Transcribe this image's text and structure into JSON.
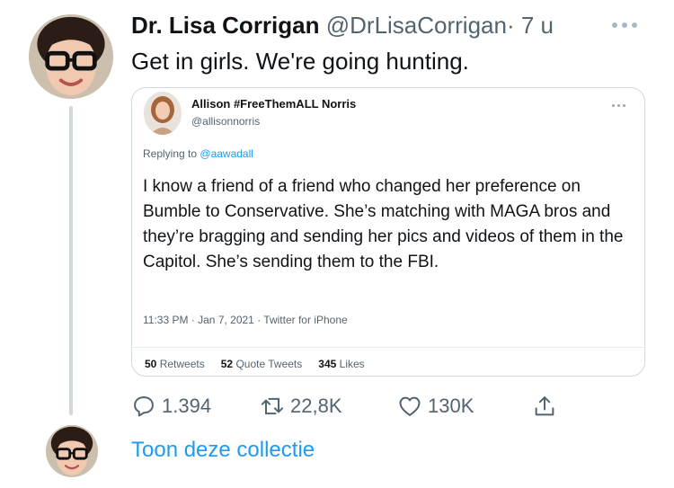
{
  "tweet": {
    "author_name": "Dr. Lisa Corrigan",
    "author_handle": "@DrLisaCorrigan",
    "separator": "·",
    "timestamp": "7 u",
    "text": "Get in girls. We're going hunting.",
    "avatar_icon": "person-with-glasses-avatar"
  },
  "quoted_tweet": {
    "author_name": "Allison #FreeThemALL Norris",
    "author_handle": "@allisonnorris",
    "replying_prefix": "Replying to",
    "replying_to": "@aawadall",
    "text": "I know a friend of a friend who changed her preference on Bumble to Conservative. She’s matching with MAGA bros and they’re bragging and sending her pics and videos of them in the Capitol. She’s sending them to the FBI.",
    "meta": "11:33 PM · Jan 7, 2021 · Twitter for iPhone",
    "stats": {
      "retweets_count": "50",
      "retweets_label": "Retweets",
      "quotes_count": "52",
      "quotes_label": "Quote Tweets",
      "likes_count": "345",
      "likes_label": "Likes"
    }
  },
  "actions": {
    "reply_count": "1.394",
    "retweet_count": "22,8K",
    "like_count": "130K"
  },
  "collection_link": "Toon deze collectie",
  "colors": {
    "accent": "#1d9bf0",
    "secondary_text": "#536471",
    "border": "#cfd9de"
  }
}
